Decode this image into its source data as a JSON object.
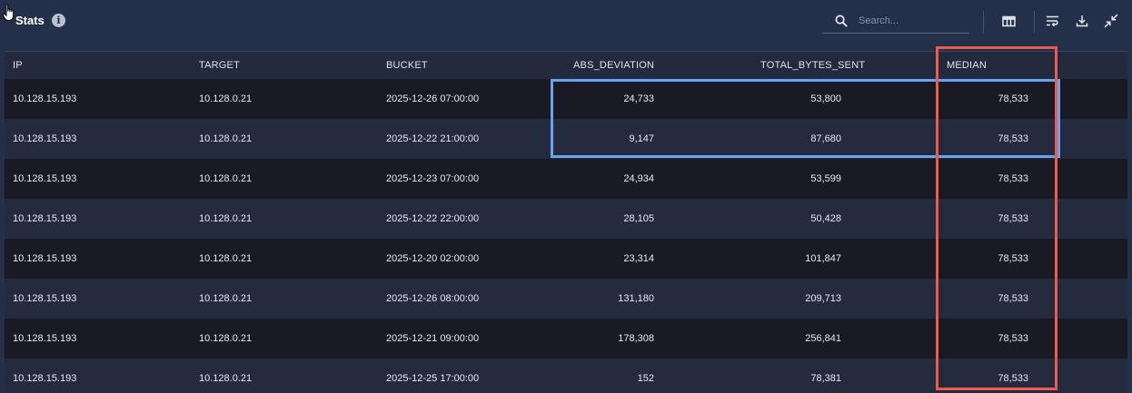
{
  "header": {
    "title": "Stats",
    "search_placeholder": "Search..."
  },
  "icons": {
    "cursor": "hand-pointer-icon",
    "info": "info-icon",
    "search": "search-icon",
    "columns": "columns-icon",
    "wrap": "wrap-text-icon",
    "download": "download-icon",
    "collapse": "collapse-icon"
  },
  "colors": {
    "highlight_red": "#ef5a4f",
    "highlight_blue": "#6aa4f0"
  },
  "table": {
    "columns": [
      "IP",
      "TARGET",
      "BUCKET",
      "ABS_DEVIATION",
      "TOTAL_BYTES_SENT",
      "MEDIAN"
    ],
    "rows": [
      {
        "ip": "10.128.15.193",
        "target": "10.128.0.21",
        "bucket": "2025-12-26 07:00:00",
        "abs_deviation": "24,733",
        "total_bytes_sent": "53,800",
        "median": "78,533"
      },
      {
        "ip": "10.128.15.193",
        "target": "10.128.0.21",
        "bucket": "2025-12-22 21:00:00",
        "abs_deviation": "9,147",
        "total_bytes_sent": "87,680",
        "median": "78,533"
      },
      {
        "ip": "10.128.15.193",
        "target": "10.128.0.21",
        "bucket": "2025-12-23 07:00:00",
        "abs_deviation": "24,934",
        "total_bytes_sent": "53,599",
        "median": "78,533"
      },
      {
        "ip": "10.128.15.193",
        "target": "10.128.0.21",
        "bucket": "2025-12-22 22:00:00",
        "abs_deviation": "28,105",
        "total_bytes_sent": "50,428",
        "median": "78,533"
      },
      {
        "ip": "10.128.15.193",
        "target": "10.128.0.21",
        "bucket": "2025-12-20 02:00:00",
        "abs_deviation": "23,314",
        "total_bytes_sent": "101,847",
        "median": "78,533"
      },
      {
        "ip": "10.128.15.193",
        "target": "10.128.0.21",
        "bucket": "2025-12-26 08:00:00",
        "abs_deviation": "131,180",
        "total_bytes_sent": "209,713",
        "median": "78,533"
      },
      {
        "ip": "10.128.15.193",
        "target": "10.128.0.21",
        "bucket": "2025-12-21 09:00:00",
        "abs_deviation": "178,308",
        "total_bytes_sent": "256,841",
        "median": "78,533"
      },
      {
        "ip": "10.128.15.193",
        "target": "10.128.0.21",
        "bucket": "2025-12-25 17:00:00",
        "abs_deviation": "152",
        "total_bytes_sent": "78,381",
        "median": "78,533"
      }
    ]
  }
}
